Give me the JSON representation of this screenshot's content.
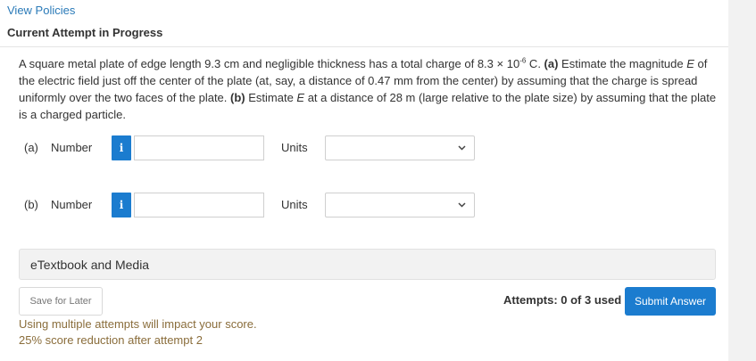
{
  "header": {
    "view_policies": "View Policies",
    "attempt_status": "Current Attempt in Progress"
  },
  "question": {
    "line1_a": "A square metal plate of edge length 9.3 cm and negligible thickness has a total charge of 8.3 × 10",
    "exponent": "-6",
    "line1_b": " C. ",
    "part_a_tag": "(a)",
    "line1_c": " Estimate the magnitude ",
    "var_e1": "E",
    "line1_d": " of the electric field just off the center of the plate (at, say, a distance of 0.47 mm from the center) by assuming that the charge is spread uniformly over the two faces of the plate. ",
    "part_b_tag": "(b)",
    "line1_e": " Estimate ",
    "var_e2": "E",
    "line1_f": " at a distance of 28 m (large relative to the plate size) by assuming that the plate is a charged particle."
  },
  "answers": [
    {
      "label": "(a)",
      "number_label": "Number",
      "info": "i",
      "value": "",
      "units_label": "Units",
      "units_value": ""
    },
    {
      "label": "(b)",
      "number_label": "Number",
      "info": "i",
      "value": "",
      "units_label": "Units",
      "units_value": ""
    }
  ],
  "etextbook": {
    "label": "eTextbook and Media"
  },
  "footer": {
    "save_label": "Save for Later",
    "warning_line1": "Using multiple attempts will impact your score.",
    "warning_line2": "25% score reduction after attempt 2",
    "attempts_text": "Attempts: 0 of 3 used",
    "submit_label": "Submit Answer"
  },
  "colors": {
    "accent": "#1b7ccf",
    "link": "#2a7ab8",
    "warning": "#8a6d3b"
  },
  "icons": {
    "info": "info-icon",
    "dropdown": "chevron-down-icon"
  }
}
